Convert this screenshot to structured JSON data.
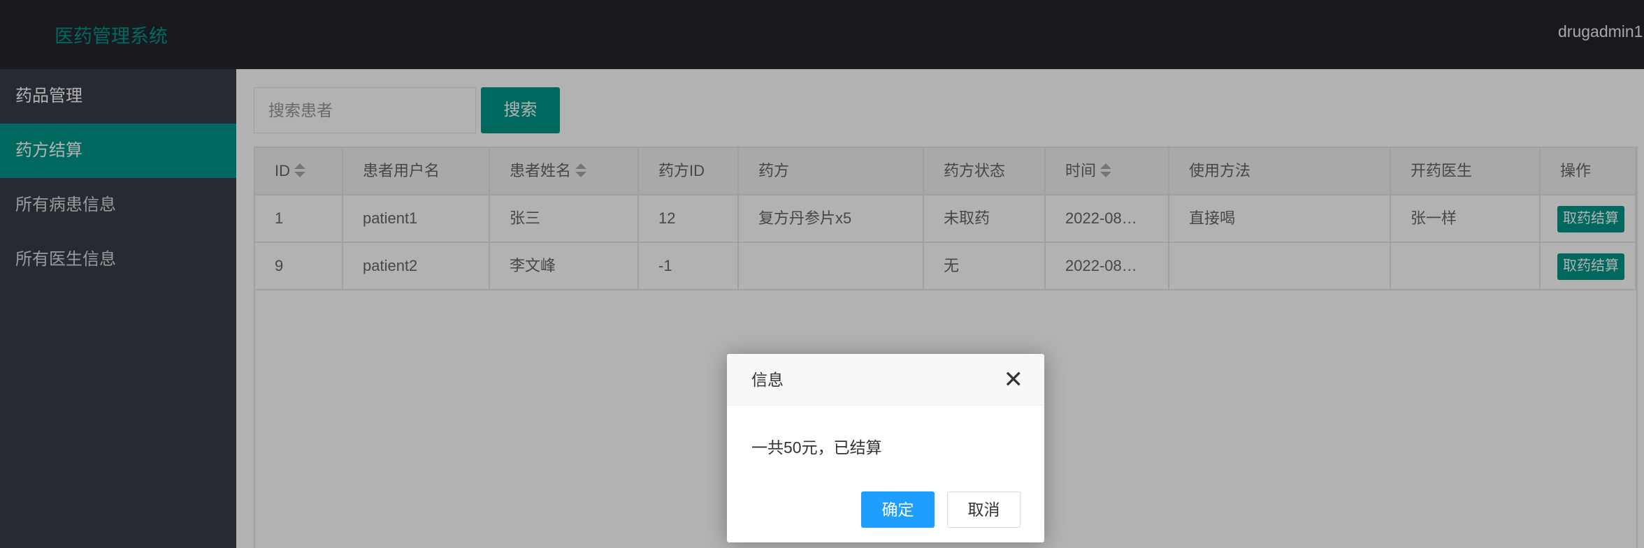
{
  "header": {
    "title": "医药管理系统",
    "user": "drugadmin1"
  },
  "sidebar": {
    "items": [
      {
        "label": "药品管理"
      },
      {
        "label": "药方结算"
      },
      {
        "label": "所有病患信息"
      },
      {
        "label": "所有医生信息"
      }
    ],
    "active": "药方结算"
  },
  "search": {
    "placeholder": "搜索患者",
    "button": "搜索"
  },
  "table": {
    "columns": [
      {
        "label": "ID",
        "sortable": true
      },
      {
        "label": "患者用户名"
      },
      {
        "label": "患者姓名",
        "sortable": true
      },
      {
        "label": "药方ID"
      },
      {
        "label": "药方"
      },
      {
        "label": "药方状态"
      },
      {
        "label": "时间",
        "sortable": true
      },
      {
        "label": "使用方法"
      },
      {
        "label": "开药医生"
      },
      {
        "label": "操作"
      }
    ],
    "rows": [
      {
        "cells": [
          "1",
          "patient1",
          "张三",
          "12",
          "复方丹参片x5",
          "未取药",
          "2022-08…",
          "直接喝",
          "张一样"
        ],
        "action": "取药结算"
      },
      {
        "cells": [
          "9",
          "patient2",
          "李文峰",
          "-1",
          "",
          "无",
          "2022-08…",
          "",
          ""
        ],
        "action": "取药结算"
      }
    ]
  },
  "dialog": {
    "title": "信息",
    "message": "一共50元，已结算",
    "ok": "确定",
    "cancel": "取消"
  },
  "colors": {
    "accent": "#009688",
    "header_bg": "#23262e",
    "sidebar_bg": "#393d49",
    "dialog_ok": "#1e9fff"
  }
}
